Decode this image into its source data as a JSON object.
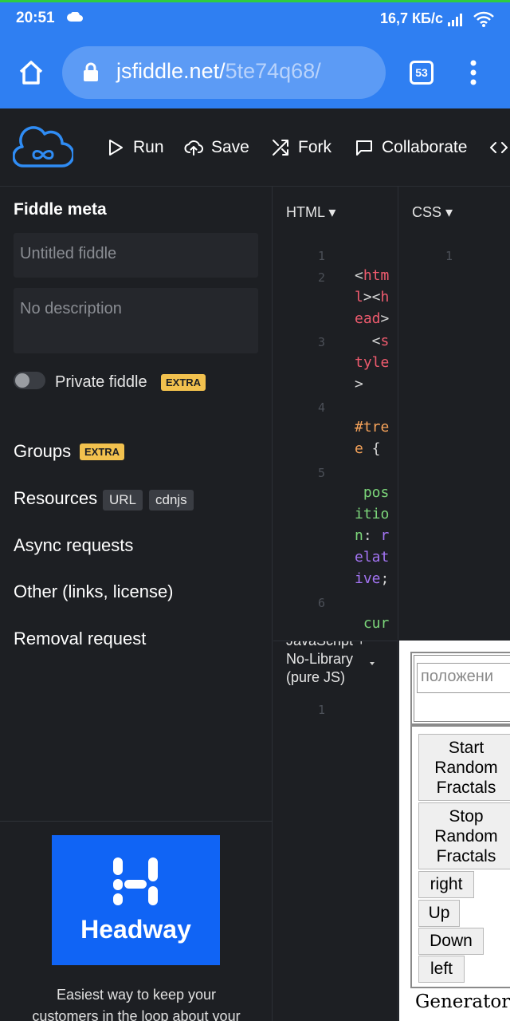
{
  "status_bar": {
    "time": "20:51",
    "speed": "16,7 КБ/с"
  },
  "browser": {
    "url_domain": "jsfiddle.net/",
    "url_path": "5te74q68/",
    "tab_count": "53"
  },
  "toolbar": {
    "run": "Run",
    "save": "Save",
    "fork": "Fork",
    "collaborate": "Collaborate"
  },
  "sidebar": {
    "meta_title": "Fiddle meta",
    "title_placeholder": "Untitled fiddle",
    "desc_placeholder": "No description",
    "private_label": "Private fiddle",
    "extra_badge": "EXTRA",
    "groups": "Groups",
    "resources": "Resources",
    "url_pill": "URL",
    "cdnjs_pill": "cdnjs",
    "async": "Async requests",
    "other": "Other (links, license)",
    "removal": "Removal request",
    "ad_brand": "Headway",
    "ad_caption_1": "Easiest way to keep your",
    "ad_caption_2": "customers in the loop about your"
  },
  "html_panel": {
    "label": "HTML ▾",
    "line_numbers": [
      "1",
      "2",
      "3",
      "4",
      "5",
      "6"
    ],
    "code": {
      "l2a": "<",
      "l2b": "htm",
      "l2c": "l",
      "l2d": "><",
      "l2e": "h",
      "l2f": "ead",
      "l2g": ">",
      "l3a": "  <",
      "l3b": "s",
      "l3c": "tyle",
      "l3d": ">",
      "l4a": "#tre",
      "l4b": "e",
      "l4c": " {",
      "l5a": " pos",
      "l5b": "itio",
      "l5c": "n",
      "l5d": ": ",
      "l5e": "r",
      "l5f": "elat",
      "l5g": "ive",
      "l5h": ";",
      "l6a": " cur"
    }
  },
  "css_panel": {
    "label": "CSS ▾",
    "line_number": "1"
  },
  "js_panel": {
    "label": "JavaScript + No-Library (pure JS)",
    "line_number": "1"
  },
  "result": {
    "input_placeholder": "положени",
    "btn_start": "Start Random Fractals",
    "btn_stop": "Stop Random Fractals",
    "btn_right": "right",
    "btn_up": "Up",
    "btn_down": "Down",
    "btn_left": "left",
    "caption": "Generator"
  }
}
